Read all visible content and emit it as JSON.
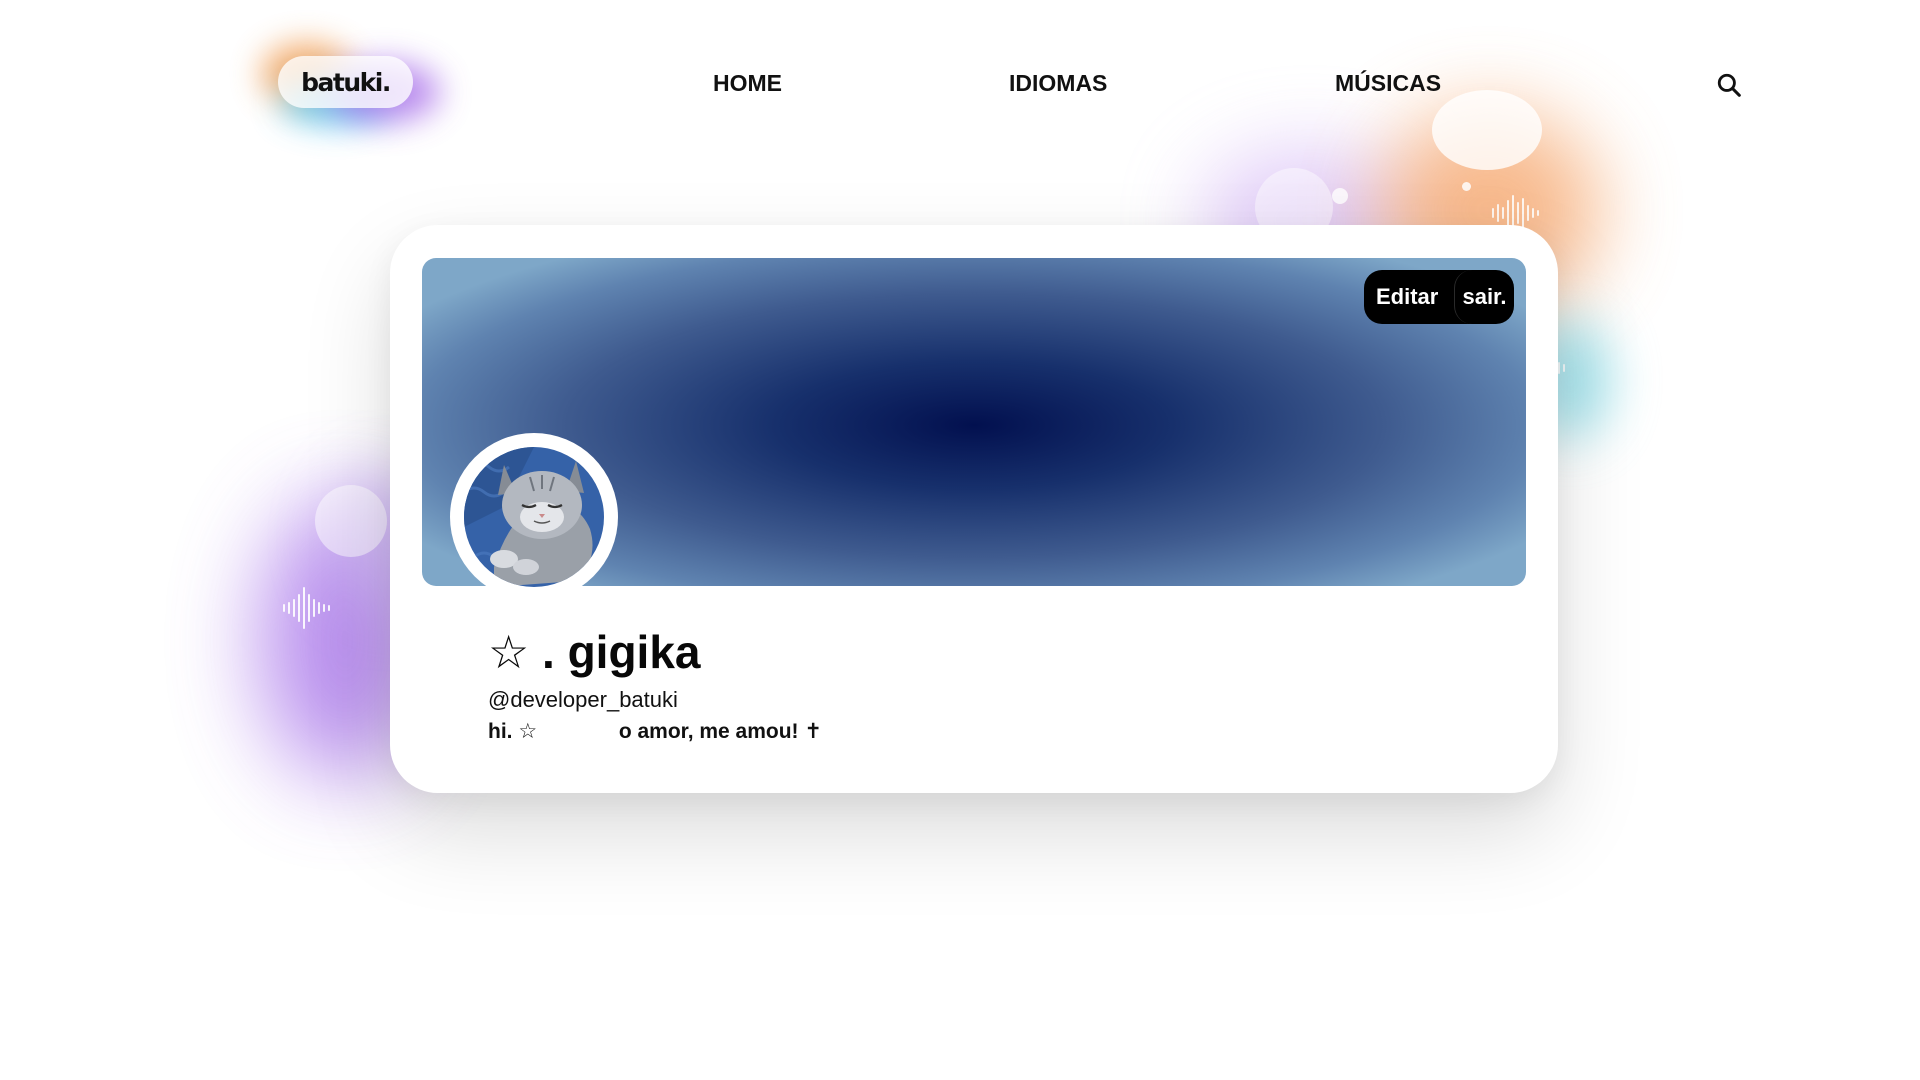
{
  "header": {
    "logo_text": "batuki.",
    "nav": [
      "HOME",
      "IDIOMAS",
      "MÚSICAS"
    ],
    "search_icon": "search-icon"
  },
  "profile": {
    "display_name": "☆ . gigika",
    "username": "@developer_batuki",
    "bio": "hi. ☆              o amor, me amou! ✝",
    "avatar": "sleeping-kitten-photo",
    "buttons": {
      "edit": "Editar",
      "logout": "sair."
    }
  },
  "colors": {
    "banner_center": "#02104f",
    "banner_edge": "#7ea7c8",
    "button_bg": "#000000",
    "accent_orange": "#f5a266",
    "accent_violet": "#a169e8",
    "accent_cyan": "#7fd9e6"
  }
}
